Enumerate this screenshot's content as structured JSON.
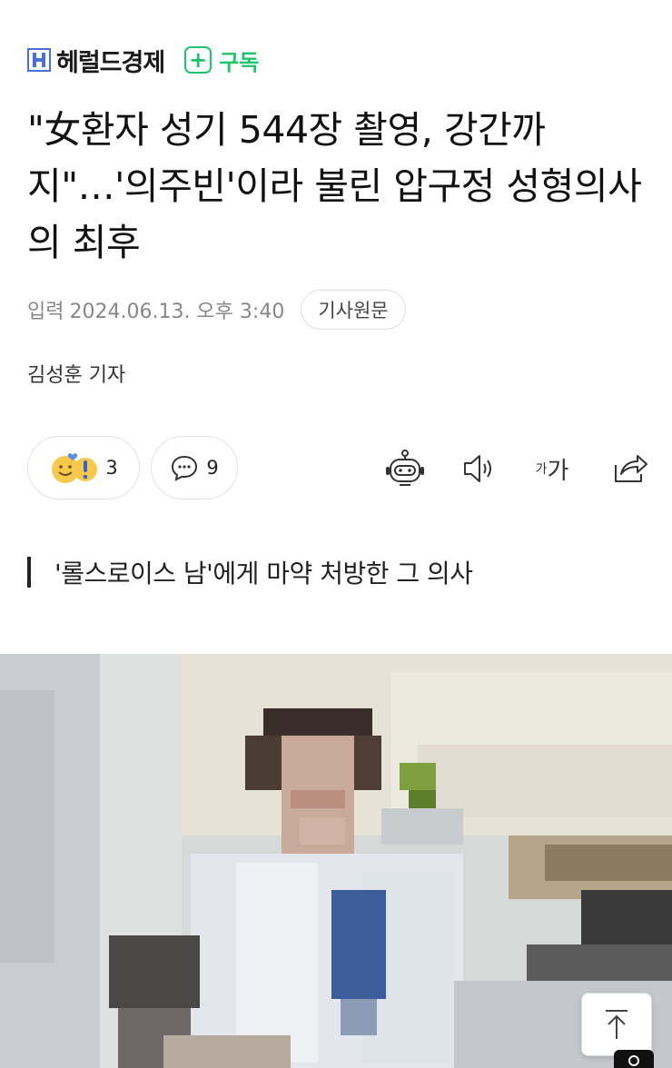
{
  "header": {
    "publisher": "헤럴드경제",
    "subscribe_label": "구독",
    "icons": {
      "logo": "publisher-logo-icon",
      "subscribe": "plus-icon"
    },
    "colors": {
      "accent": "#1ec46b",
      "logo": "#4a6fd8"
    }
  },
  "article": {
    "title": "\"女환자 성기 544장 촬영, 강간까지\"…'의주빈'이라 불린 압구정 성형의사의 최후",
    "meta": {
      "published_label": "입력",
      "published_at": "2024.06.13. 오후 3:40",
      "original_button": "기사원문"
    },
    "reporter": "김성훈 기자",
    "reactions": {
      "count": "3",
      "icon": "emoji-reaction-icon"
    },
    "comments": {
      "count": "9",
      "icon": "comment-icon"
    },
    "tools": {
      "summary_icon": "robot-icon",
      "listen_icon": "speaker-icon",
      "font_small": "가",
      "font_large": "가",
      "share_icon": "share-icon"
    },
    "subheading": "'롤스로이스 남'에게 마약 처방한 그 의사"
  },
  "scroll_top_icon": "arrow-up-icon"
}
